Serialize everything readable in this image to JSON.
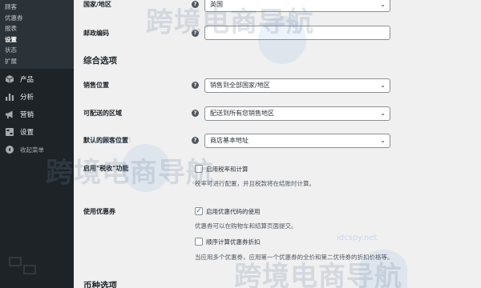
{
  "sidebar": {
    "submenu": [
      "顾客",
      "优惠券",
      "报表",
      "设置",
      "状态",
      "扩展"
    ],
    "menu": {
      "products": "产品",
      "analytics": "分析",
      "marketing": "营销",
      "settings": "设置",
      "collapse": "收起菜单"
    }
  },
  "form": {
    "country_label": "国家/地区",
    "country_value": "英国",
    "postcode_label": "邮政编码",
    "general_options_title": "综合选项",
    "selling_location_label": "销售位置",
    "selling_location_value": "销售到全部国家/地区",
    "shipping_location_label": "可配送的区域",
    "shipping_location_value": "配送到所有您销售地区",
    "default_customer_location_label": "默认的顾客位置",
    "default_customer_location_value": "商店基本地址",
    "enable_taxes_label": "启用\"税收\"功能",
    "enable_taxes_checkbox": "启用税率和计算",
    "enable_taxes_desc": "税率可进行配置，并且税款将在结账时计算。",
    "coupons_label": "使用优惠券",
    "coupons_checkbox": "启用优惠代码的使用",
    "coupons_desc": "优惠券可以在购物车和结算页面提交。",
    "sequential_checkbox": "顺序计算优惠券折扣",
    "sequential_desc": "当应用多个优惠券，应用第一个优惠券的全价和第二优待券的折扣价格等。",
    "currency_options_title": "币种选项"
  },
  "watermark": {
    "text": "跨境电商导航",
    "url": "idcspy.net"
  },
  "icons": {
    "help": "?",
    "chevron": "⌄",
    "check": "✓"
  }
}
